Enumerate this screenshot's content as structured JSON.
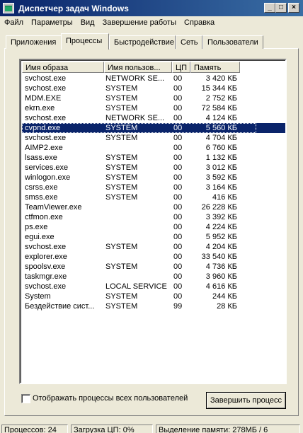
{
  "window": {
    "title": "Диспетчер задач Windows",
    "min": "_",
    "max": "□",
    "close": "×"
  },
  "menu": [
    "Файл",
    "Параметры",
    "Вид",
    "Завершение работы",
    "Справка"
  ],
  "tabs": [
    "Приложения",
    "Процессы",
    "Быстродействие",
    "Сеть",
    "Пользователи"
  ],
  "columns": {
    "name": "Имя образа",
    "user": "Имя пользов...",
    "cpu": "ЦП",
    "mem": "Память"
  },
  "processes": [
    {
      "name": "svchost.exe",
      "user": "NETWORK SE...",
      "cpu": "00",
      "mem": "3 420 КБ"
    },
    {
      "name": "svchost.exe",
      "user": "SYSTEM",
      "cpu": "00",
      "mem": "15 344 КБ"
    },
    {
      "name": "MDM.EXE",
      "user": "SYSTEM",
      "cpu": "00",
      "mem": "2 752 КБ"
    },
    {
      "name": "ekrn.exe",
      "user": "SYSTEM",
      "cpu": "00",
      "mem": "72 584 КБ"
    },
    {
      "name": "svchost.exe",
      "user": "NETWORK SE...",
      "cpu": "00",
      "mem": "4 124 КБ"
    },
    {
      "name": "cvpnd.exe",
      "user": "SYSTEM",
      "cpu": "00",
      "mem": "5 560 КБ",
      "selected": true
    },
    {
      "name": "svchost.exe",
      "user": "SYSTEM",
      "cpu": "00",
      "mem": "4 704 КБ"
    },
    {
      "name": "AIMP2.exe",
      "user": "",
      "cpu": "00",
      "mem": "6 760 КБ"
    },
    {
      "name": "lsass.exe",
      "user": "SYSTEM",
      "cpu": "00",
      "mem": "1 132 КБ"
    },
    {
      "name": "services.exe",
      "user": "SYSTEM",
      "cpu": "00",
      "mem": "3 012 КБ"
    },
    {
      "name": "winlogon.exe",
      "user": "SYSTEM",
      "cpu": "00",
      "mem": "3 592 КБ"
    },
    {
      "name": "csrss.exe",
      "user": "SYSTEM",
      "cpu": "00",
      "mem": "3 164 КБ"
    },
    {
      "name": "smss.exe",
      "user": "SYSTEM",
      "cpu": "00",
      "mem": "416 КБ"
    },
    {
      "name": "TeamViewer.exe",
      "user": "",
      "cpu": "00",
      "mem": "26 228 КБ"
    },
    {
      "name": "ctfmon.exe",
      "user": "",
      "cpu": "00",
      "mem": "3 392 КБ"
    },
    {
      "name": "ps.exe",
      "user": "",
      "cpu": "00",
      "mem": "4 224 КБ"
    },
    {
      "name": "egui.exe",
      "user": "",
      "cpu": "00",
      "mem": "5 952 КБ"
    },
    {
      "name": "svchost.exe",
      "user": "SYSTEM",
      "cpu": "00",
      "mem": "4 204 КБ"
    },
    {
      "name": "explorer.exe",
      "user": "",
      "cpu": "00",
      "mem": "33 540 КБ"
    },
    {
      "name": "spoolsv.exe",
      "user": "SYSTEM",
      "cpu": "00",
      "mem": "4 736 КБ"
    },
    {
      "name": "taskmgr.exe",
      "user": "",
      "cpu": "00",
      "mem": "3 960 КБ"
    },
    {
      "name": "svchost.exe",
      "user": "LOCAL SERVICE",
      "cpu": "00",
      "mem": "4 616 КБ"
    },
    {
      "name": "System",
      "user": "SYSTEM",
      "cpu": "00",
      "mem": "244 КБ"
    },
    {
      "name": "Бездействие сист...",
      "user": "SYSTEM",
      "cpu": "99",
      "mem": "28 КБ"
    }
  ],
  "show_all_label": "Отображать процессы всех пользователей",
  "show_all_checked": false,
  "end_process_label": "Завершить процесс",
  "status": {
    "processes": "Процессов: 24",
    "cpu": "Загрузка ЦП: 0%",
    "commit": "Выделение памяти: 278МБ / 6"
  }
}
